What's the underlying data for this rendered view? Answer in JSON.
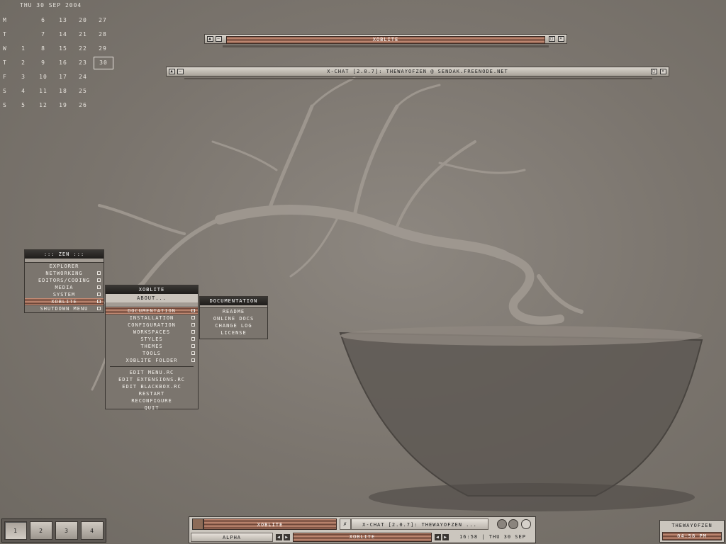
{
  "calendar": {
    "header": "THU 30 SEP 2004",
    "rows": [
      {
        "day": "M",
        "dates": [
          "",
          "6",
          "13",
          "20",
          "27"
        ]
      },
      {
        "day": "T",
        "dates": [
          "",
          "7",
          "14",
          "21",
          "28"
        ]
      },
      {
        "day": "W",
        "dates": [
          "1",
          "8",
          "15",
          "22",
          "29"
        ]
      },
      {
        "day": "T",
        "dates": [
          "2",
          "9",
          "16",
          "23",
          "30"
        ]
      },
      {
        "day": "F",
        "dates": [
          "3",
          "10",
          "17",
          "24",
          ""
        ]
      },
      {
        "day": "S",
        "dates": [
          "4",
          "11",
          "18",
          "25",
          ""
        ]
      },
      {
        "day": "S",
        "dates": [
          "5",
          "12",
          "19",
          "26",
          ""
        ]
      }
    ],
    "today": "30"
  },
  "windows": {
    "xoblite_title": "XOBLITE",
    "xchat_title": "X-CHAT [2.0.7]: THEWAYOFZEN @ SENDAK.FREENODE.NET"
  },
  "menus": {
    "zen": {
      "title": "::: ZEN :::",
      "items": [
        "EXPLORER",
        "NETWORKING",
        "EDITORS/CODING",
        "MEDIA",
        "SYSTEM",
        "XOBLITE",
        "SHUTDOWN MENU"
      ],
      "selected": "XOBLITE"
    },
    "xoblite": {
      "title": "XOBLITE",
      "about": "ABOUT...",
      "submenus": [
        "DOCUMENTATION",
        "INSTALLATION",
        "CONFIGURATION",
        "WORKSPACES",
        "STYLES",
        "THEMES",
        "TOOLS",
        "XOBLITE FOLDER"
      ],
      "actions": [
        "EDIT MENU.RC",
        "EDIT EXTENSIONS.RC",
        "EDIT BLACKBOX.RC",
        "RESTART",
        "RECONFIGURE",
        "QUIT"
      ],
      "selected": "DOCUMENTATION"
    },
    "documentation": {
      "title": "DOCUMENTATION",
      "items": [
        "README",
        "ONLINE DOCS",
        "CHANGE LOG",
        "LICENSE"
      ]
    }
  },
  "pager": {
    "workspaces": [
      "1",
      "2",
      "3",
      "4"
    ],
    "active": "1"
  },
  "taskbar": {
    "task1": "XOBLITE",
    "task2": "X-CHAT [2.0.7]: THEWAYOFZEN ...",
    "workspace_name": "ALPHA",
    "window_label": "XOBLITE",
    "clock": "16:58 | THU 30 SEP"
  },
  "usertray": {
    "user": "THEWAYOFZEN",
    "time": "04:58 PM"
  },
  "colors": {
    "accent": "#8a5a48",
    "desktop": "#7a746d"
  }
}
